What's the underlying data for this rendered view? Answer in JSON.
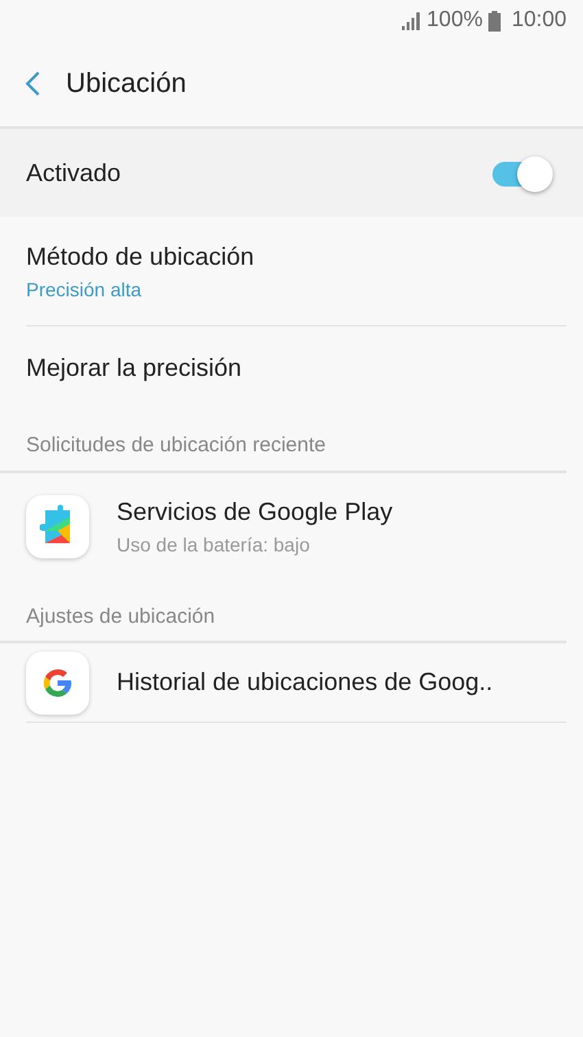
{
  "status_bar": {
    "battery": "100%",
    "time": "10:00"
  },
  "header": {
    "title": "Ubicación"
  },
  "master_switch": {
    "label": "Activado",
    "on": true
  },
  "settings": [
    {
      "title": "Método de ubicación",
      "subtitle": "Precisión alta"
    },
    {
      "title": "Mejorar la precisión"
    }
  ],
  "sections": [
    {
      "heading": "Solicitudes de ubicación reciente",
      "items": [
        {
          "kind": "play",
          "title": "Servicios de Google Play",
          "subtitle": "Uso de la batería: bajo"
        }
      ]
    },
    {
      "heading": "Ajustes de ubicación",
      "items": [
        {
          "kind": "google",
          "title": "Historial de ubicaciones de Goog.."
        }
      ]
    }
  ]
}
